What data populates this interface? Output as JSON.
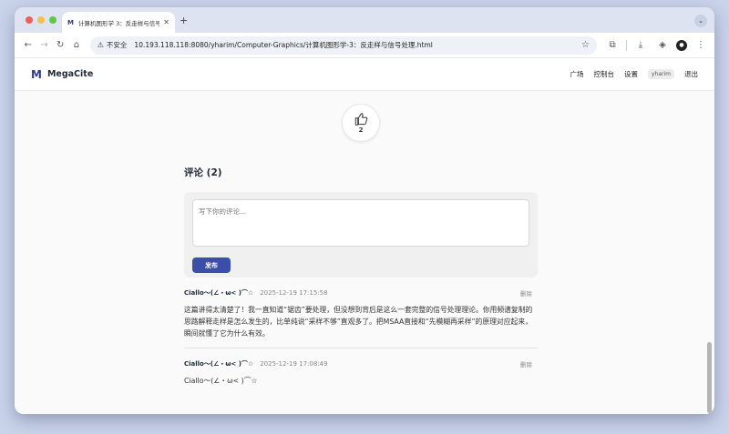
{
  "browser": {
    "tab_favicon": "M",
    "tab_title": "计算机图形学 3：反走样与信号",
    "newtab": "+",
    "tab_menu": "⌄",
    "insecure_label": "不安全",
    "url": "10.193.118.118:8080/yharim/Computer-Graphics/计算机图形学-3：反走样与信号处理.html"
  },
  "site": {
    "logo_mark": "M",
    "name": "MegaCite",
    "nav": {
      "plaza": "广场",
      "dashboard": "控制台",
      "settings": "设置",
      "user": "yharim",
      "logout": "退出"
    }
  },
  "like": {
    "count": "2"
  },
  "comments_section": {
    "title": "评论 (2)",
    "placeholder": "写下你的评论...",
    "post_label": "发布"
  },
  "comments": [
    {
      "author": "Ciallo～(∠・ω< )⌒☆",
      "time": "2025-12-19 17:15:58",
      "delete_label": "删除",
      "body": "这篇讲得太清楚了！我一直知道“锯齿”要处理，但没想到背后是这么一套完整的信号处理理论。你用频谱复制的思路解释走样是怎么发生的，比单纯说“采样不够”直观多了。把MSAA直接和“先模糊再采样”的原理对应起来，瞬间就懂了它为什么有效。"
    },
    {
      "author": "Ciallo～(∠・ω< )⌒☆",
      "time": "2025-12-19 17:08:49",
      "delete_label": "删除",
      "body": "Ciallo～(∠・ω< )⌒☆"
    }
  ]
}
